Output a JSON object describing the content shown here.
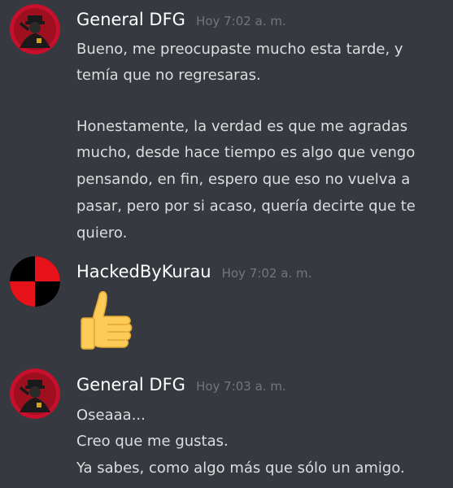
{
  "messages": [
    {
      "username": "General DFG",
      "timestamp": "Hoy 7:02 a. m.",
      "lines": [
        "Bueno, me preocupaste mucho esta tarde, y",
        "temía que no regresaras.",
        "",
        "Honestamente, la verdad es que me agradas",
        "mucho, desde hace tiempo es algo que vengo",
        "pensando, en fin, espero que eso no vuelva a",
        "pasar, pero por si acaso, quería decirte que te",
        "quiero."
      ]
    },
    {
      "username": "HackedByKurau",
      "timestamp": "Hoy 7:02 a. m.",
      "emoji": "thumbs-up"
    },
    {
      "username": "General DFG",
      "timestamp": "Hoy 7:03 a. m.",
      "lines": [
        "Oseaaa...",
        "Creo que me gustas.",
        "Ya sabes, como algo más que sólo un amigo."
      ]
    }
  ],
  "colors": {
    "background": "#36393f",
    "username": "#ffffff",
    "timestamp": "#72767d",
    "text": "#dcddde",
    "avatar_red": "#c8102e",
    "avatar_black": "#000000"
  }
}
